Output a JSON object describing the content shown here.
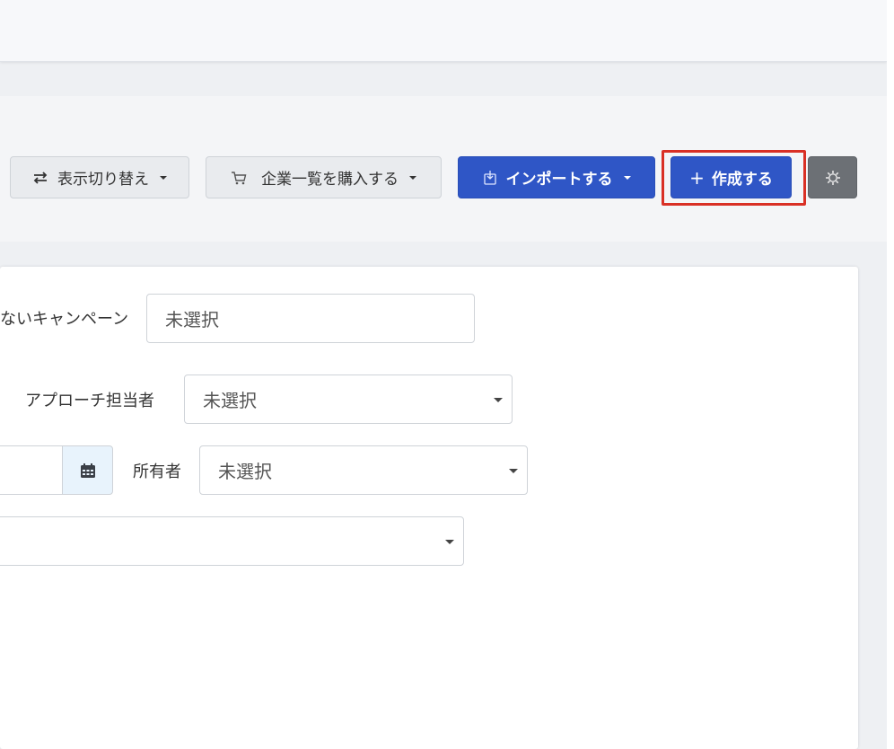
{
  "toolbar": {
    "toggle_view_label": "表示切り替え",
    "buy_company_list_label": "企業一覧を購入する",
    "import_label": "インポートする",
    "create_label": "作成する"
  },
  "icons": {
    "toggle": "arrows-exchange-icon",
    "cart": "cart-icon",
    "import": "import-icon",
    "plus": "plus-icon",
    "gear": "gear-icon",
    "calendar": "calendar-icon"
  },
  "colors": {
    "primary": "#2f56c6",
    "highlight": "#d93025",
    "dark_button": "#6c7075"
  },
  "filters": {
    "campaign": {
      "label": "ないキャンペーン",
      "value": "未選択"
    },
    "approach_owner": {
      "label": "アプローチ担当者",
      "value": "未選択"
    },
    "owner": {
      "label": "所有者",
      "value": "未選択"
    },
    "bottom_select": {
      "value": ""
    }
  }
}
